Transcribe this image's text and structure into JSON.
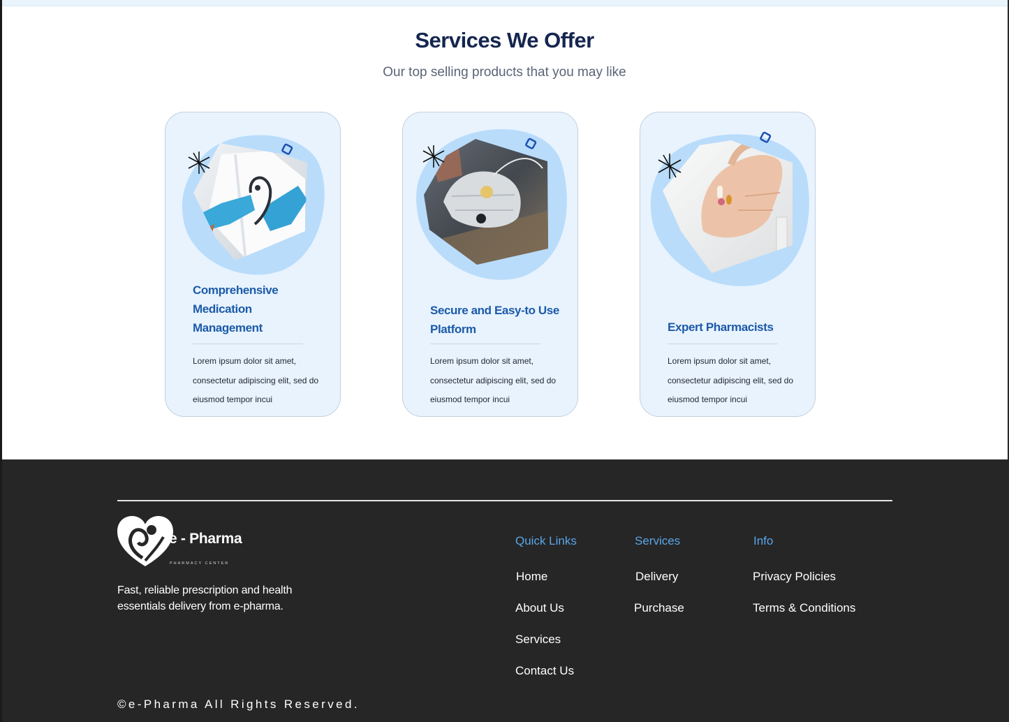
{
  "services": {
    "title": "Services We Offer",
    "subtitle": "Our top selling products that you may like",
    "cards": [
      {
        "title": "Comprehensive Medication Management",
        "text": "Lorem ipsum dolor sit amet, consectetur adipiscing elit, sed do eiusmod tempor incui",
        "image_icon": "gloved-hands-stethoscope-photo"
      },
      {
        "title": "Secure and Easy-to Use Platform",
        "text": "Lorem ipsum dolor sit amet, consectetur adipiscing elit, sed do eiusmod tempor incui",
        "image_icon": "face-mask-photo"
      },
      {
        "title": "Expert Pharmacists",
        "text": "Lorem ipsum dolor sit amet, consectetur adipiscing elit, sed do eiusmod tempor incui",
        "image_icon": "pills-in-hand-photo"
      }
    ]
  },
  "footer": {
    "logo_name": "e - Pharma",
    "logo_tagline": "PHARMACY CENTER",
    "description": "Fast, reliable prescription and health essentials delivery from e-pharma.",
    "columns": [
      {
        "heading": "Quick Links",
        "links": [
          "Home",
          "About Us",
          "Services",
          "Contact Us"
        ]
      },
      {
        "heading": "Services",
        "links": [
          "Delivery",
          "Purchase"
        ]
      },
      {
        "heading": "Info",
        "links": [
          "Privacy Policies",
          "Terms & Conditions"
        ]
      }
    ],
    "copyright": "©e-Pharma All Rights Reserved."
  },
  "colors": {
    "title": "#14254f",
    "card_bg": "#e8f3fe",
    "card_title": "#1c5aa8",
    "blob": "#b9dcfb",
    "footer_bg": "#262626",
    "footer_heading": "#5aa5e8"
  }
}
